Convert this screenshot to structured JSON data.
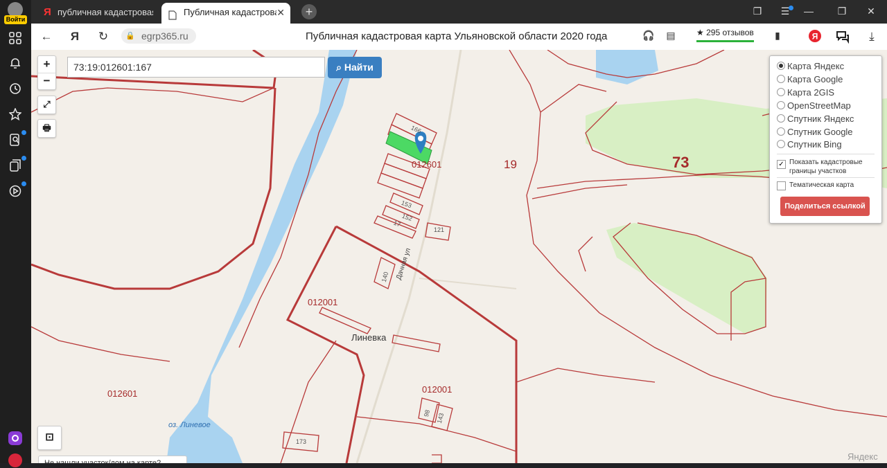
{
  "sidebar": {
    "login_label": "Войти",
    "icons": [
      "grid-icon",
      "bell-icon",
      "history-icon",
      "star-icon",
      "search-doc-icon",
      "collections-icon",
      "play-icon",
      "alice-icon",
      "profile-icon"
    ]
  },
  "tabs": [
    {
      "label": "публичная кадастровая к",
      "icon": "Я"
    },
    {
      "label": "Публичная кадастрова",
      "icon": "page"
    }
  ],
  "addressbar": {
    "url": "egrp365.ru",
    "page_title": "Публичная кадастровая карта Ульяновской области 2020 года",
    "reviews": "★ 295 отзывов",
    "ya_logo": "Я"
  },
  "map": {
    "search_value": "73:19:012601:167",
    "search_button": "Найти",
    "zoom_in": "+",
    "zoom_out": "−",
    "layers": [
      {
        "label": "Карта Яндекс",
        "selected": true
      },
      {
        "label": "Карта Google",
        "selected": false
      },
      {
        "label": "Карта 2GIS",
        "selected": false
      },
      {
        "label": "OpenStreetMap",
        "selected": false
      },
      {
        "label": "Спутник Яндекс",
        "selected": false
      },
      {
        "label": "Спутник Google",
        "selected": false
      },
      {
        "label": "Спутник Bing",
        "selected": false
      }
    ],
    "show_borders_label": "Показать кадастровые границы участков",
    "show_borders_checked": true,
    "thematic_label": "Тематическая карта",
    "thematic_checked": false,
    "share_button": "Поделиться ссылкой",
    "labels": {
      "q1": "19",
      "q2": "73",
      "q3": "012601",
      "q4": "012001",
      "q5": "012601",
      "q6": "012001",
      "village": "Линевка",
      "lake": "оз. Линевое",
      "street": "Дачная ул",
      "p166": "166",
      "p153": "153",
      "p152": "152",
      "p17": "17",
      "p121": "121",
      "p140": "140",
      "p98": "98",
      "p143": "143",
      "p173": "173",
      "yandex": "Яндекс"
    },
    "bottom_hint": "Не нашли участок/дом на карте?"
  },
  "colors": {
    "cadastral_border": "#b83a3a",
    "water": "#a9d3f0",
    "forest": "#d8efc4",
    "selected_parcel": "#4cd964",
    "marker": "#2d7fc1",
    "search_button": "#3a7fc1",
    "share_button": "#d9534f"
  }
}
